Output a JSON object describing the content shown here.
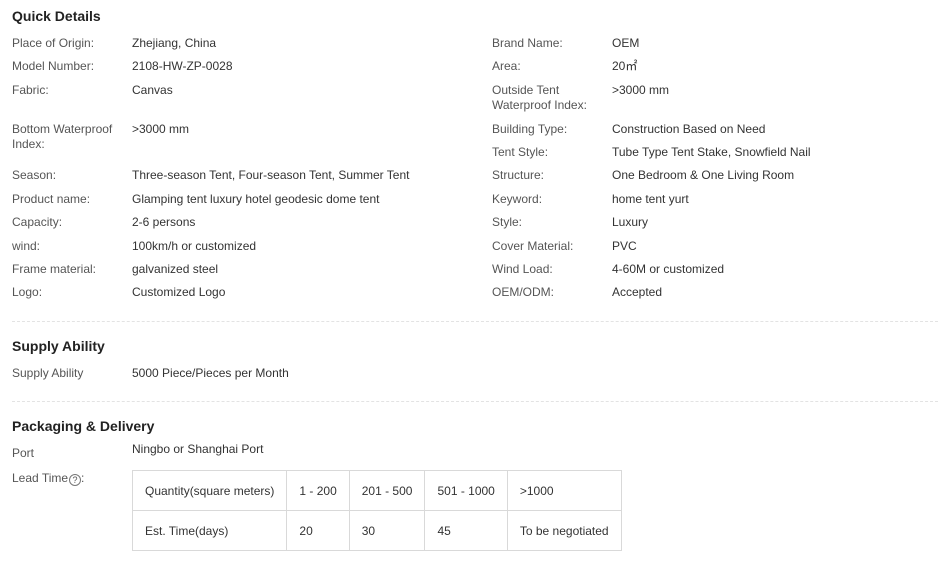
{
  "quick_details": {
    "title": "Quick Details",
    "left": [
      {
        "label": "Place of Origin:",
        "value": "Zhejiang, China"
      },
      {
        "label": "Model Number:",
        "value": "2108-HW-ZP-0028"
      },
      {
        "label": "Fabric:",
        "value": "Canvas"
      },
      {
        "label": "Bottom Waterproof Index:",
        "value": ">3000 mm"
      },
      {
        "label": "Season:",
        "value": "Three-season Tent, Four-season Tent, Summer Tent"
      },
      {
        "label": "Product name:",
        "value": "Glamping tent luxury hotel geodesic dome tent"
      },
      {
        "label": "Capacity:",
        "value": "2-6 persons"
      },
      {
        "label": "wind:",
        "value": "100km/h or customized"
      },
      {
        "label": "Frame material:",
        "value": "galvanized steel"
      },
      {
        "label": "Logo:",
        "value": "Customized Logo"
      }
    ],
    "right": [
      {
        "label": "Brand Name:",
        "value": "OEM"
      },
      {
        "label": "Area:",
        "value": "20㎡"
      },
      {
        "label": "Outside Tent Waterproof Index:",
        "value": ">3000 mm"
      },
      {
        "label": "Building Type:",
        "value": "Construction Based on Need"
      },
      {
        "label": "Tent Style:",
        "value": "Tube Type Tent Stake, Snowfield Nail"
      },
      {
        "label": "Structure:",
        "value": "One Bedroom & One Living Room"
      },
      {
        "label": "Keyword:",
        "value": "home tent yurt"
      },
      {
        "label": "Style:",
        "value": "Luxury"
      },
      {
        "label": "Cover Material:",
        "value": "PVC"
      },
      {
        "label": "Wind Load:",
        "value": "4-60M or customized"
      },
      {
        "label": "OEM/ODM:",
        "value": "Accepted"
      }
    ]
  },
  "supply_ability": {
    "title": "Supply Ability",
    "label": "Supply Ability",
    "value": "5000 Piece/Pieces per Month"
  },
  "packaging_delivery": {
    "title": "Packaging & Delivery",
    "port_label": "Port",
    "port_value": "Ningbo or Shanghai Port",
    "lead_time_label": "Lead Time",
    "help_glyph": "?",
    "lead_time_suffix": ":",
    "lead_time_table": {
      "row1": [
        "Quantity(square meters)",
        "1 - 200",
        "201 - 500",
        "501 - 1000",
        ">1000"
      ],
      "row2": [
        "Est. Time(days)",
        "20",
        "30",
        "45",
        "To be negotiated"
      ]
    }
  }
}
